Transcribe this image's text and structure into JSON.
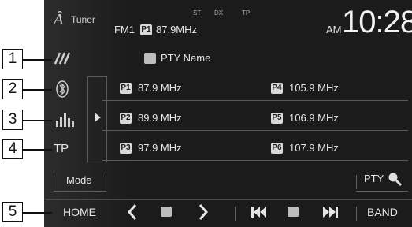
{
  "header": {
    "source_label": "Tuner",
    "band": "FM1",
    "preset_badge": "P1",
    "frequency": "87.9MHz",
    "indicator_st": "ST",
    "indicator_dx": "DX",
    "indicator_tp": "TP",
    "ampm": "AM",
    "clock": "10:28"
  },
  "pty_name": "PTY Name",
  "presets": [
    {
      "badge": "P1",
      "label": "87.9 MHz"
    },
    {
      "badge": "P2",
      "label": "89.9 MHz"
    },
    {
      "badge": "P3",
      "label": "97.9 MHz"
    },
    {
      "badge": "P4",
      "label": "105.9 MHz"
    },
    {
      "badge": "P5",
      "label": "106.9 MHz"
    },
    {
      "badge": "P6",
      "label": "107.9 MHz"
    }
  ],
  "left_buttons": {
    "tp_label": "TP",
    "mode_label": "Mode",
    "home_label": "HOME"
  },
  "right_buttons": {
    "pty_label": "PTY",
    "band_label": "BAND"
  },
  "callouts": [
    "1",
    "2",
    "3",
    "4",
    "5"
  ],
  "icons": [
    "antenna-icon",
    "bluetooth-icon",
    "equalizer-icon",
    "expand-arrow-icon",
    "pty-name-icon",
    "search-icon",
    "prev-icon",
    "stop-icon",
    "next-icon",
    "skip-back-icon",
    "skip-forward-icon"
  ]
}
